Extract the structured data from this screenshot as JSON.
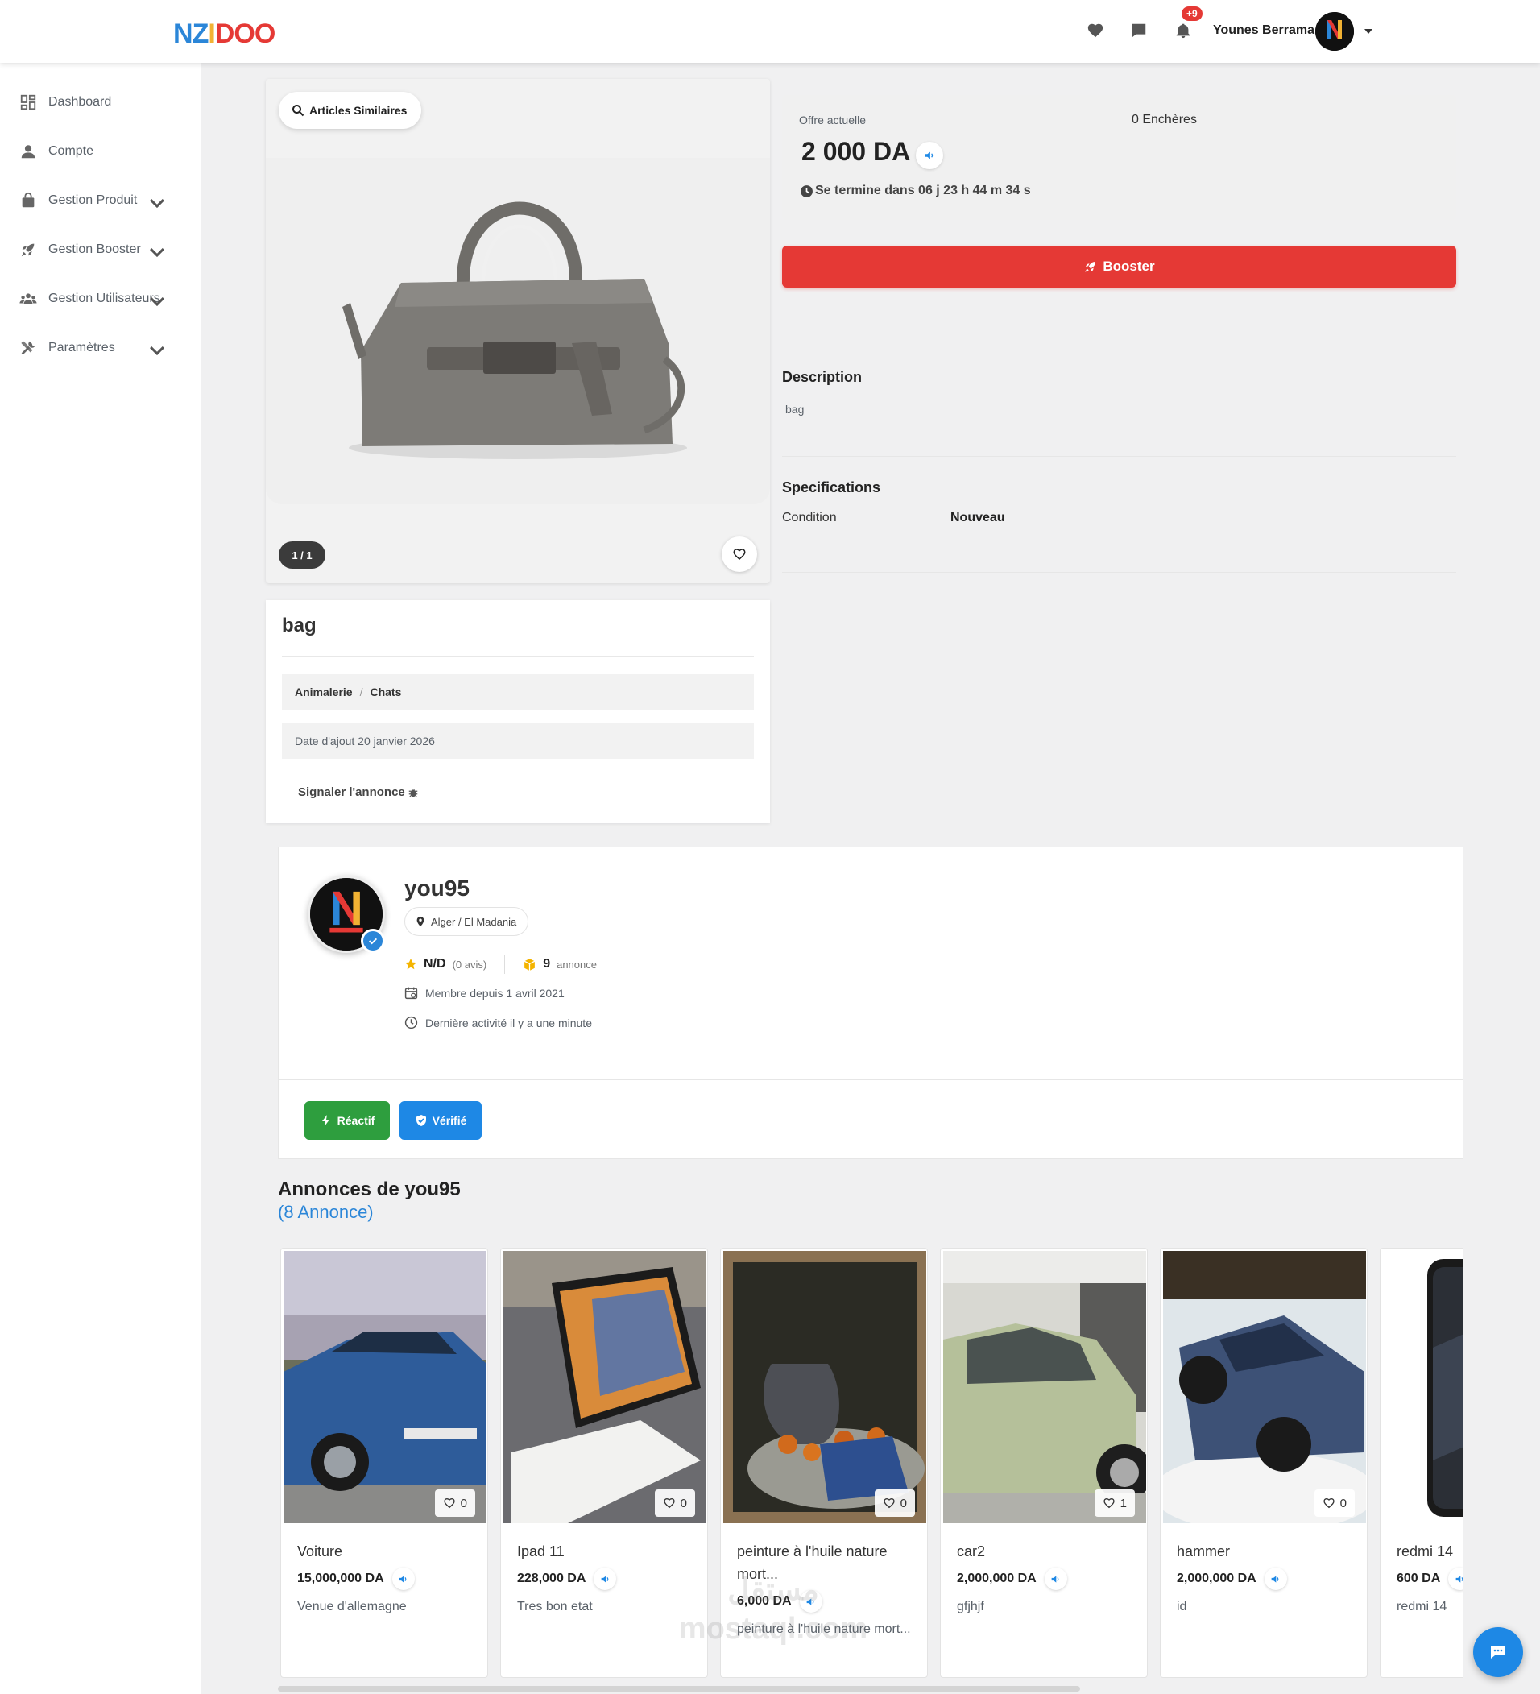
{
  "app": {
    "logo_letters": [
      "N",
      "Z",
      "I",
      "D",
      "O",
      "O"
    ]
  },
  "header": {
    "notification_count": "+9",
    "user_name": "Younes Berrama"
  },
  "sidebar": {
    "items": [
      {
        "label": "Dashboard",
        "icon": "dashboard-icon"
      },
      {
        "label": "Compte",
        "icon": "user-icon"
      },
      {
        "label": "Gestion Produit",
        "icon": "bag-icon"
      },
      {
        "label": "Gestion Booster",
        "icon": "rocket-icon"
      },
      {
        "label": "Gestion Utilisateurs",
        "icon": "users-icon"
      },
      {
        "label": "Paramètres",
        "icon": "tools-icon"
      }
    ]
  },
  "product": {
    "similar_label": "Articles Similaires",
    "image_counter": "1 / 1",
    "title": "bag",
    "category": "Animalerie",
    "subcategory": "Chats",
    "date_added": "Date d'ajout 20 janvier 2026",
    "report_label": "Signaler l'annonce"
  },
  "offer": {
    "label": "Offre actuelle",
    "bids": "0 Enchères",
    "price": "2 000 DA",
    "ends": "Se termine dans 06 j 23 h 44 m 34 s",
    "booster_label": "Booster"
  },
  "description": {
    "title": "Description",
    "text": "bag"
  },
  "specifications": {
    "title": "Specifications",
    "condition_key": "Condition",
    "condition_value": "Nouveau"
  },
  "seller": {
    "name": "you95",
    "location": "Alger / El Madania",
    "rating": "N/D",
    "reviews": "(0 avis)",
    "listing_count": "9",
    "listing_word": "annonce",
    "member_since": "Membre depuis 1 avril 2021",
    "last_activity": "Dernière activité il y a une minute",
    "badge_reactive": "Réactif",
    "badge_verified": "Vérifié"
  },
  "listings": {
    "title": "Annonces de you95",
    "count": "(8 Annonce)",
    "items": [
      {
        "title": "Voiture",
        "price": "15,000,000 DA",
        "desc": "Venue d'allemagne",
        "likes": "0"
      },
      {
        "title": "Ipad 11",
        "price": "228,000 DA",
        "desc": "Tres bon etat",
        "likes": "0"
      },
      {
        "title": "peinture à l'huile nature mort...",
        "price": "6,000 DA",
        "desc": "peinture à l'huile nature mort...",
        "likes": "0"
      },
      {
        "title": "car2",
        "price": "2,000,000 DA",
        "desc": "gfjhjf",
        "likes": "1"
      },
      {
        "title": "hammer",
        "price": "2,000,000 DA",
        "desc": "id",
        "likes": "0"
      },
      {
        "title": "redmi 14",
        "price": "600 DA",
        "desc": "redmi 14",
        "likes": ""
      }
    ]
  },
  "watermark": {
    "line1": "مستقل",
    "line2": "mostaql.com"
  },
  "colors": {
    "primary": "#1e88e5",
    "danger": "#e53935",
    "success": "#2e9e3e",
    "link": "#2b86d8"
  }
}
